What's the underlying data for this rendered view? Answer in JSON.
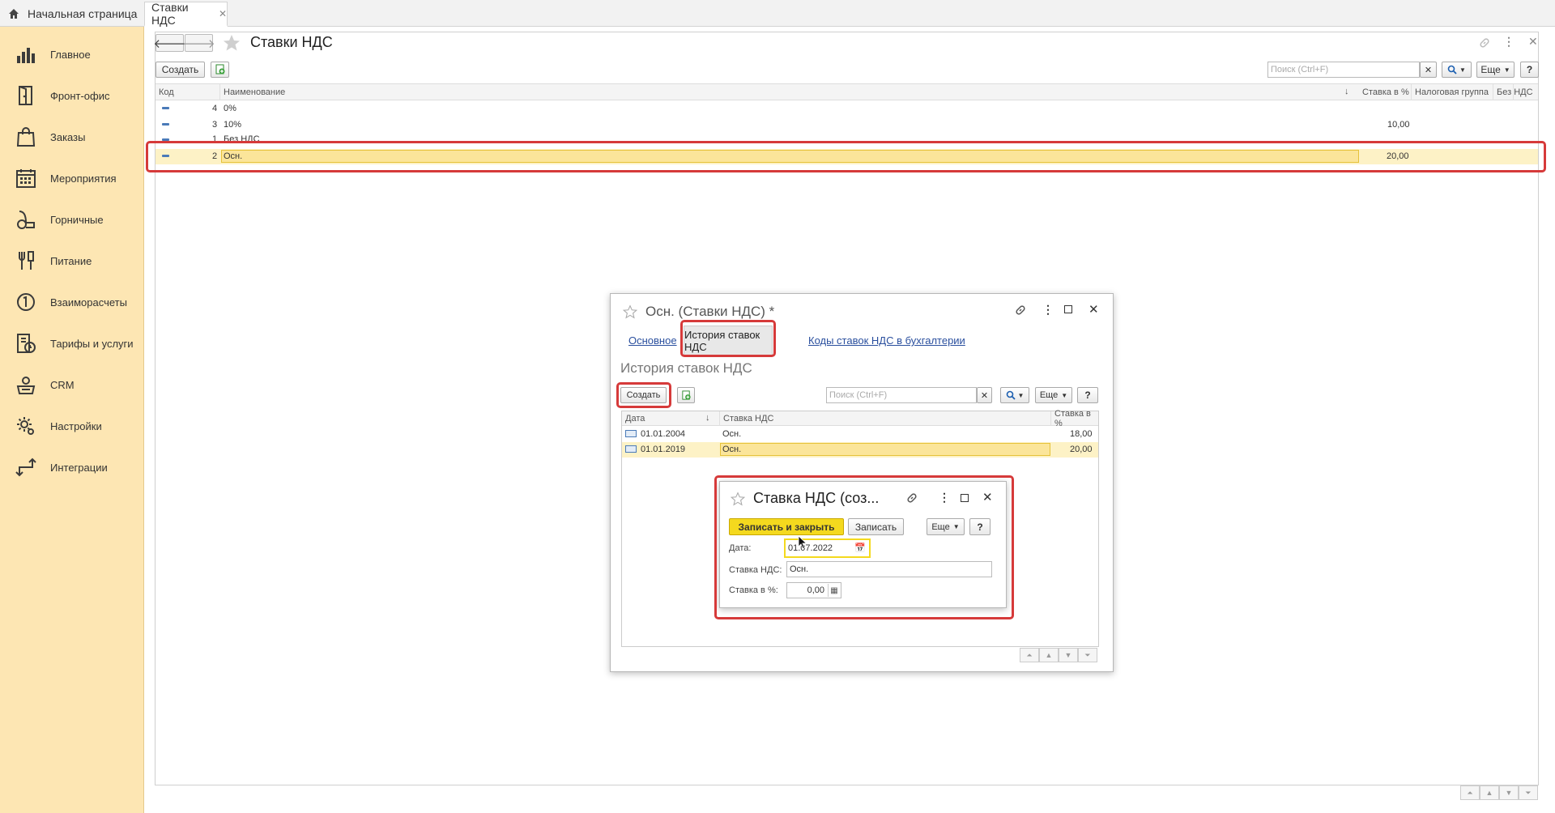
{
  "tabs": {
    "home": "Начальная страница",
    "active": "Ставки НДС"
  },
  "sidebar": {
    "items": [
      {
        "label": "Главное",
        "icon": "chart-icon"
      },
      {
        "label": "Фронт-офис",
        "icon": "door-icon"
      },
      {
        "label": "Заказы",
        "icon": "bag-icon"
      },
      {
        "label": "Мероприятия",
        "icon": "calendar-icon"
      },
      {
        "label": "Горничные",
        "icon": "vacuum-icon"
      },
      {
        "label": "Питание",
        "icon": "food-icon"
      },
      {
        "label": "Взаиморасчеты",
        "icon": "payment-icon"
      },
      {
        "label": "Тарифы и услуги",
        "icon": "tariff-icon"
      },
      {
        "label": "CRM",
        "icon": "crm-icon"
      },
      {
        "label": "Настройки",
        "icon": "gear-icon"
      },
      {
        "label": "Интеграции",
        "icon": "integration-icon"
      }
    ]
  },
  "main": {
    "title": "Ставки НДС",
    "create": "Создать",
    "search_placeholder": "Поиск (Ctrl+F)",
    "more": "Еще",
    "help": "?",
    "columns": {
      "code": "Код",
      "name": "Наименование",
      "rate": "Ставка в %",
      "group": "Налоговая группа",
      "novat": "Без НДС"
    },
    "rows": [
      {
        "code": "4",
        "name": "0%",
        "rate": ""
      },
      {
        "code": "3",
        "name": "10%",
        "rate": "10,00"
      },
      {
        "code": "1",
        "name": "Без НДС",
        "rate": ""
      },
      {
        "code": "2",
        "name": "Осн.",
        "rate": "20,00"
      }
    ]
  },
  "dialog1": {
    "title": "Осн. (Ставки НДС) *",
    "tabs": {
      "basic": "Основное",
      "history": "История ставок НДС",
      "codes": "Коды ставок НДС в бухгалтерии"
    },
    "section": "История ставок НДС",
    "create": "Создать",
    "search_placeholder": "Поиск (Ctrl+F)",
    "more": "Еще",
    "help": "?",
    "columns": {
      "date": "Дата",
      "vat": "Ставка НДС",
      "rate": "Ставка в %"
    },
    "rows": [
      {
        "date": "01.01.2004",
        "vat": "Осн.",
        "rate": "18,00"
      },
      {
        "date": "01.01.2019",
        "vat": "Осн.",
        "rate": "20,00"
      }
    ]
  },
  "dialog2": {
    "title": "Ставка НДС (соз...",
    "save_close": "Записать и закрыть",
    "save": "Записать",
    "more": "Еще",
    "help": "?",
    "date_label": "Дата:",
    "date_value": "01.07.2022",
    "vat_label": "Ставка НДС:",
    "vat_value": "Осн.",
    "rate_label": "Ставка в %:",
    "rate_value": "0,00"
  },
  "colors": {
    "accent": "#d63a3a",
    "selection": "#fbe59a",
    "sidebar": "#fde6b3",
    "primary_button": "#f4d91e"
  }
}
